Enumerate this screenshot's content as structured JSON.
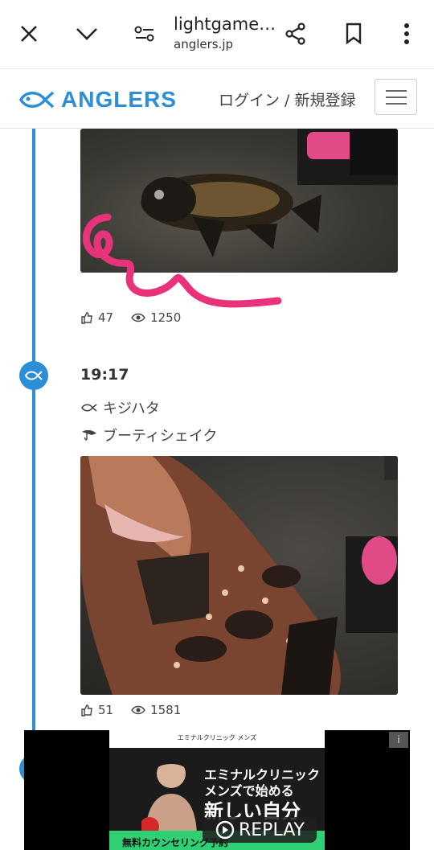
{
  "browser": {
    "title": "lightgame…",
    "domain": "anglers.jp",
    "icons": [
      "close-icon",
      "chevron-down-icon",
      "site-settings-icon",
      "share-icon",
      "bookmark-icon",
      "more-icon"
    ]
  },
  "site_header": {
    "logo_text": "ANGLERS",
    "login_label": "ログイン / 新規登録"
  },
  "entries": [
    {
      "likes": "47",
      "views": "1250"
    },
    {
      "time": "19:17",
      "species": "キジハタ",
      "lure": "ブーティシェイク",
      "likes": "51",
      "views": "1581"
    }
  ],
  "ad": {
    "brand": "エミナルクリニック メンズ",
    "headline_line1": "エミナルクリニック",
    "headline_line2": "メンズで始める",
    "headline_line3": "新しい自分",
    "cta": "無料カウンセリング予約",
    "replay_label": "REPLAY",
    "info_label": "i"
  },
  "colors": {
    "accent": "#2b8ed6",
    "annotation": "#e8337a"
  }
}
